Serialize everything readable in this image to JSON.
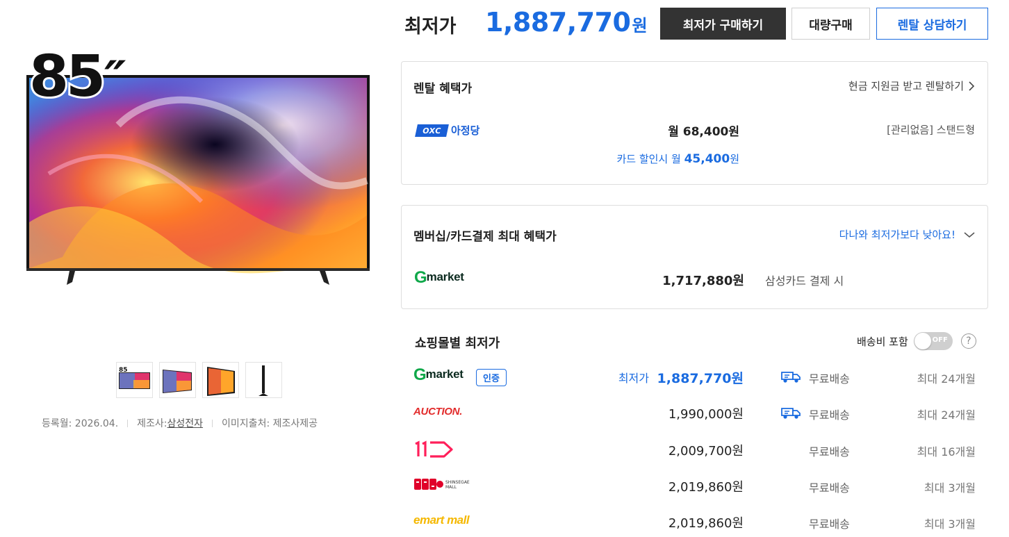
{
  "product": {
    "size_badge": "85",
    "size_unit": "″",
    "meta": {
      "registered": "등록월: 2026.04.",
      "maker_label": "제조사:",
      "maker": "삼성전자",
      "image_source": "이미지출처: 제조사제공"
    },
    "thumbnails": [
      "front-85",
      "angle",
      "side-angle",
      "side-profile"
    ]
  },
  "price_bar": {
    "label": "최저가",
    "price": "1,887,770",
    "won": "원",
    "buy_button": "최저가 구매하기",
    "bulk_button": "대량구매",
    "rental_button": "렌탈 상담하기"
  },
  "rental": {
    "title": "렌탈 혜택가",
    "link": "현금 지원금 받고 렌탈하기",
    "partner_mark": "OXC",
    "partner_name": "아정당",
    "monthly_price": "월 68,400원",
    "type": "[관리없음] 스탠드형",
    "card_prefix": "카드 할인시 월",
    "card_price": "45,400",
    "card_won": "원"
  },
  "membership": {
    "title": "멤버십/카드결제 최대 혜택가",
    "link": "다나와 최저가보다 낮아요!",
    "store_logo_G": "G",
    "store_logo_rest": "market",
    "price": "1,717,880원",
    "condition": "삼성카드 결제 시"
  },
  "malls": {
    "title": "쇼핑몰별 최저가",
    "shipping_toggle_label": "배송비 포함",
    "toggle_state": "OFF",
    "help": "?",
    "cert_badge": "인증",
    "lowest_tag": "최저가",
    "rows": [
      {
        "store": "Gmarket",
        "price": "1,887,770원",
        "shipping": "무료배송",
        "installment": "최대 24개월"
      },
      {
        "store": "AUCTION.",
        "price": "1,990,000원",
        "shipping": "무료배송",
        "installment": "최대 24개월"
      },
      {
        "store": "11st",
        "price": "2,009,700원",
        "shipping": "무료배송",
        "installment": "최대 16개월"
      },
      {
        "store": "SSG",
        "price": "2,019,860원",
        "shipping": "무료배송",
        "installment": "최대 3개월"
      },
      {
        "store": "emart mall",
        "price": "2,019,860원",
        "shipping": "무료배송",
        "installment": "최대 3개월"
      }
    ]
  },
  "colors": {
    "accent_blue": "#1a6be0",
    "dark_button": "#333333",
    "gmarket_green": "#10a84a",
    "auction_red": "#e22b2b",
    "elevenst_pink": "#ff1f5a",
    "emart_yellow": "#f5b800"
  }
}
